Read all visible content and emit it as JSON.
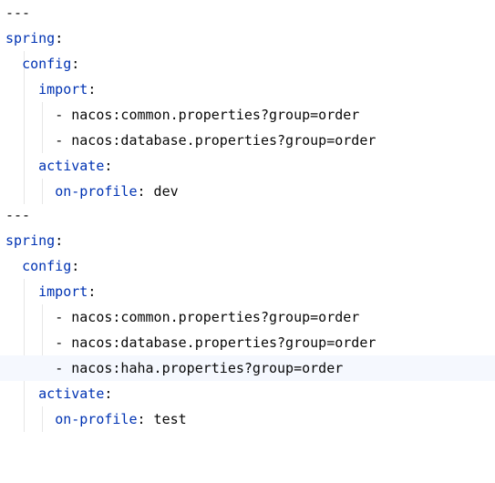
{
  "editor": {
    "lines": [
      {
        "type": "sep",
        "text": "---"
      },
      {
        "type": "kv",
        "key": "spring",
        "colon": ":",
        "value": ""
      },
      {
        "type": "kv",
        "key": "config",
        "colon": ":",
        "value": ""
      },
      {
        "type": "kv",
        "key": "import",
        "colon": ":",
        "value": ""
      },
      {
        "type": "item",
        "dash": "- ",
        "value": "nacos:common.properties?group=order"
      },
      {
        "type": "item",
        "dash": "- ",
        "value": "nacos:database.properties?group=order"
      },
      {
        "type": "kv",
        "key": "activate",
        "colon": ":",
        "value": ""
      },
      {
        "type": "kv",
        "key": "on-profile",
        "colon": ":",
        "value": " dev"
      },
      {
        "type": "sep",
        "text": "---"
      },
      {
        "type": "kv",
        "key": "spring",
        "colon": ":",
        "value": ""
      },
      {
        "type": "kv",
        "key": "config",
        "colon": ":",
        "value": ""
      },
      {
        "type": "kv",
        "key": "import",
        "colon": ":",
        "value": ""
      },
      {
        "type": "item",
        "dash": "- ",
        "value": "nacos:common.properties?group=order"
      },
      {
        "type": "item",
        "dash": "- ",
        "value": "nacos:database.properties?group=order"
      },
      {
        "type": "item",
        "dash": "- ",
        "value": "nacos:haha.properties?group=order"
      },
      {
        "type": "kv",
        "key": "activate",
        "colon": ":",
        "value": ""
      },
      {
        "type": "kv",
        "key": "on-profile",
        "colon": ":",
        "value": " test"
      }
    ],
    "current_line_index": 14,
    "intention_bulb_line_index": 13,
    "colors": {
      "key": "#0033b3",
      "value": "#080808",
      "current_line_bg": "#f5f8fe",
      "indent_guide": "#e6e6e6",
      "bulb": "#f0c419"
    },
    "icons": {
      "intention": "lightbulb-icon"
    }
  }
}
